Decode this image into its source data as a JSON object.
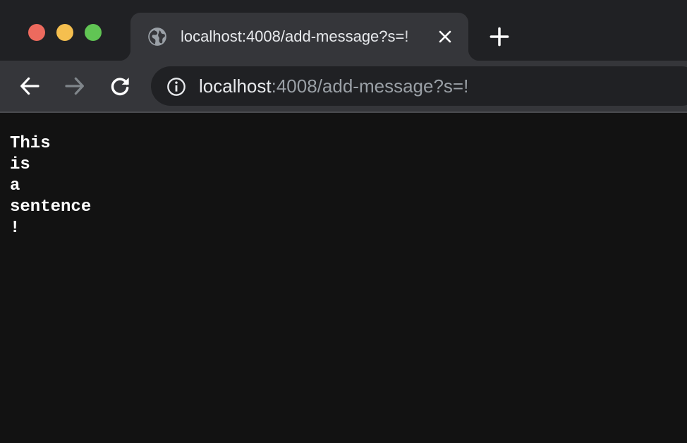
{
  "window": {
    "controls": [
      "close",
      "minimize",
      "zoom"
    ]
  },
  "tab": {
    "title": "localhost:4008/add-message?s=!",
    "favicon": "globe-icon",
    "close_icon": "close-icon"
  },
  "new_tab_icon": "plus-icon",
  "toolbar": {
    "back_icon": "back-arrow-icon",
    "forward_icon": "forward-arrow-icon",
    "reload_icon": "reload-icon"
  },
  "address_bar": {
    "info_icon": "info-icon",
    "host": "localhost",
    "rest": ":4008/add-message?s=!"
  },
  "page": {
    "lines": [
      "This",
      "is",
      "a",
      "sentence",
      "!"
    ]
  },
  "colors": {
    "tabstrip_bg": "#202124",
    "active_tab_bg": "#35363a",
    "page_bg": "#121212",
    "text": "#ffffff",
    "url_dim": "#9aa0a6",
    "traffic_red": "#ed6a5e",
    "traffic_yellow": "#f5bf4f",
    "traffic_green": "#61c554"
  }
}
